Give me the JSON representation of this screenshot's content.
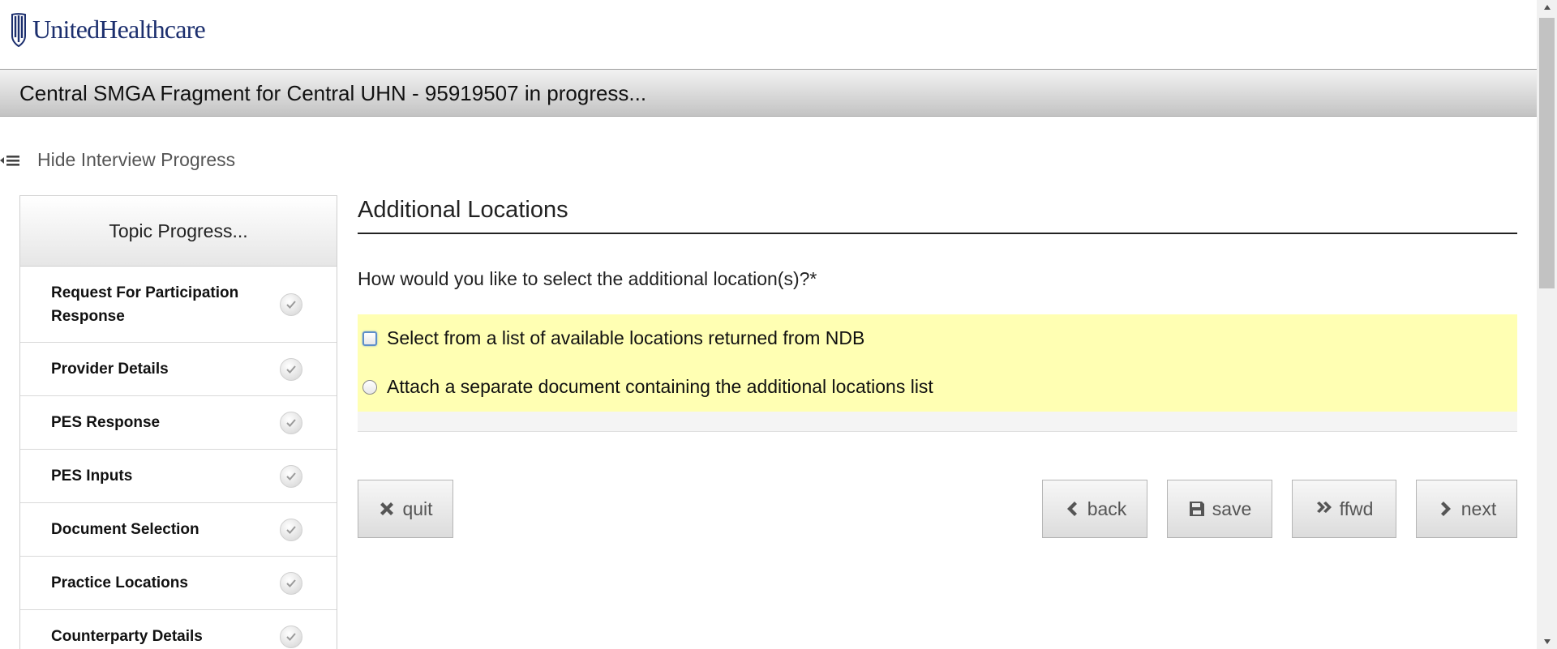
{
  "brand": {
    "name": "UnitedHealthcare"
  },
  "title_bar": {
    "text": "Central SMGA Fragment for Central UHN - 95919507 in progress..."
  },
  "progress_toggle": {
    "label": "Hide Interview Progress",
    "icon": "collapse-list-icon"
  },
  "sidebar": {
    "header": "Topic Progress...",
    "items": [
      {
        "label": "Request For Participation Response",
        "status": "complete"
      },
      {
        "label": "Provider Details",
        "status": "complete"
      },
      {
        "label": "PES Response",
        "status": "complete"
      },
      {
        "label": "PES Inputs",
        "status": "complete"
      },
      {
        "label": "Document Selection",
        "status": "complete"
      },
      {
        "label": "Practice Locations",
        "status": "complete"
      },
      {
        "label": "Counterparty Details",
        "status": "complete"
      }
    ]
  },
  "main": {
    "section_title": "Additional Locations",
    "question": "How would you like to select the additional location(s)?",
    "required_marker": "*",
    "options": [
      {
        "label": "Select from a list of available locations returned from NDB",
        "selected": false,
        "focused": true
      },
      {
        "label": "Attach a separate document containing the additional locations list",
        "selected": false,
        "focused": false
      }
    ],
    "highlight_color": "#ffffb3"
  },
  "buttons": {
    "quit": {
      "label": "quit",
      "icon": "close-x-icon"
    },
    "back": {
      "label": "back",
      "icon": "chevron-left-icon"
    },
    "save": {
      "label": "save",
      "icon": "floppy-disk-icon"
    },
    "ffwd": {
      "label": "ffwd",
      "icon": "double-chevron-right-icon"
    },
    "next": {
      "label": "next",
      "icon": "chevron-right-icon"
    }
  }
}
